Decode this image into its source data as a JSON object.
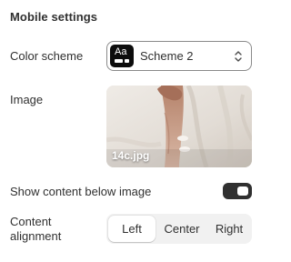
{
  "section": {
    "title": "Mobile settings"
  },
  "color_scheme": {
    "label": "Color scheme",
    "swatch_text": "Aa",
    "value": "Scheme 2",
    "icon": "chevron-up-down-icon"
  },
  "image": {
    "label": "Image",
    "filename": "14c.jpg"
  },
  "show_content": {
    "label": "Show content below image",
    "enabled": true
  },
  "content_alignment": {
    "label_line1": "Content",
    "label_line2": "alignment",
    "options": [
      "Left",
      "Center",
      "Right"
    ],
    "selected": "Left"
  },
  "colors": {
    "text": "#303030",
    "toggle_on": "#303030",
    "segment_bg": "#f1f1f1",
    "swatch_bg": "#0c0c0c"
  }
}
